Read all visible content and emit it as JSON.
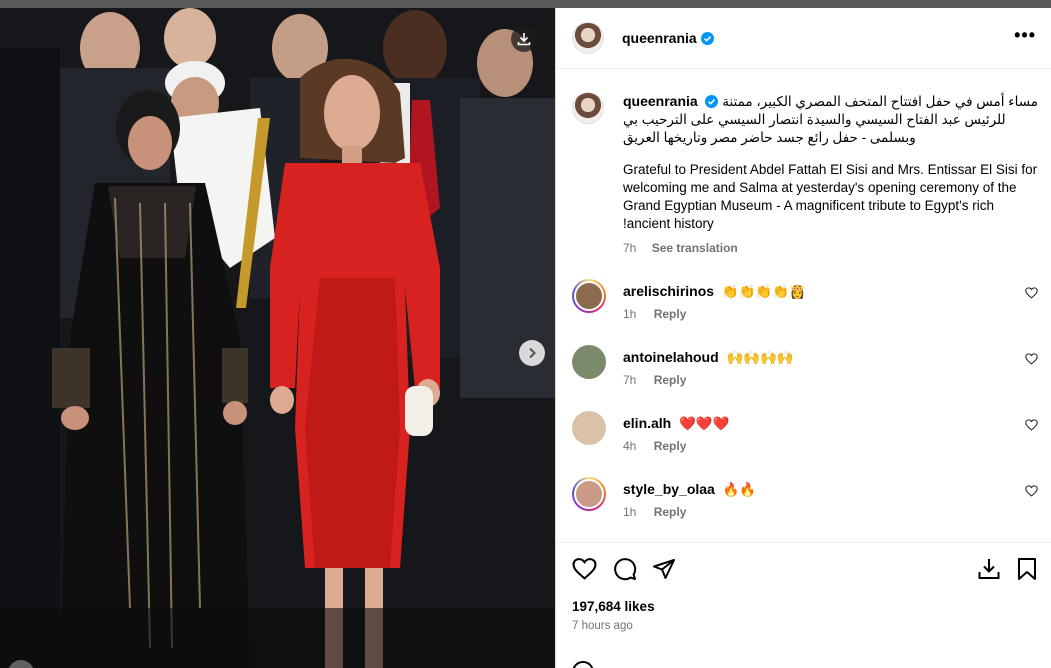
{
  "post": {
    "username": "queenrania",
    "verified": true,
    "more_label": "•••"
  },
  "caption": {
    "username": "queenrania",
    "arabic_text": "مساء أمس في حفل افتتاح المتحف المصري الكبير، ممتنة للرئيس عبد الفتاح السيسي والسيدة انتصار السيسي على الترحيب بي وبسلمى - حفل رائع جسد حاضر مصر وتاريخها العريق",
    "english_text": "Grateful to President Abdel Fattah El Sisi and Mrs. Entissar El Sisi for welcoming me and Salma at yesterday's opening ceremony of the Grand Egyptian Museum - A magnificent tribute to Egypt's rich !ancient history",
    "time": "7h",
    "see_translation": "See translation"
  },
  "comments": [
    {
      "username": "arelischirinos",
      "text": "👏👏👏👏👸",
      "time": "1h",
      "reply": "Reply",
      "avatar_color": "#8a6b4f",
      "ring": true
    },
    {
      "username": "antoinelahoud",
      "text": "🙌🙌🙌🙌",
      "time": "7h",
      "reply": "Reply",
      "avatar_color": "#7a8a6a",
      "ring": false
    },
    {
      "username": "elin.alh",
      "text": "❤️❤️❤️",
      "time": "4h",
      "reply": "Reply",
      "avatar_color": "#d9c3a8",
      "ring": false
    },
    {
      "username": "style_by_olaa",
      "text": "🔥🔥",
      "time": "1h",
      "reply": "Reply",
      "avatar_color": "#c99a86",
      "ring": true
    }
  ],
  "stats": {
    "likes": "197,684 likes",
    "posted": "7 hours ago"
  },
  "icons": {
    "like": "heart-icon",
    "comment": "comment-icon",
    "share": "share-icon",
    "download": "download-icon",
    "save": "bookmark-icon",
    "next": "chevron-right-icon"
  },
  "colors": {
    "verified_blue": "#0095f6",
    "red_dress": "#d8221f",
    "muted_text": "#737373"
  }
}
